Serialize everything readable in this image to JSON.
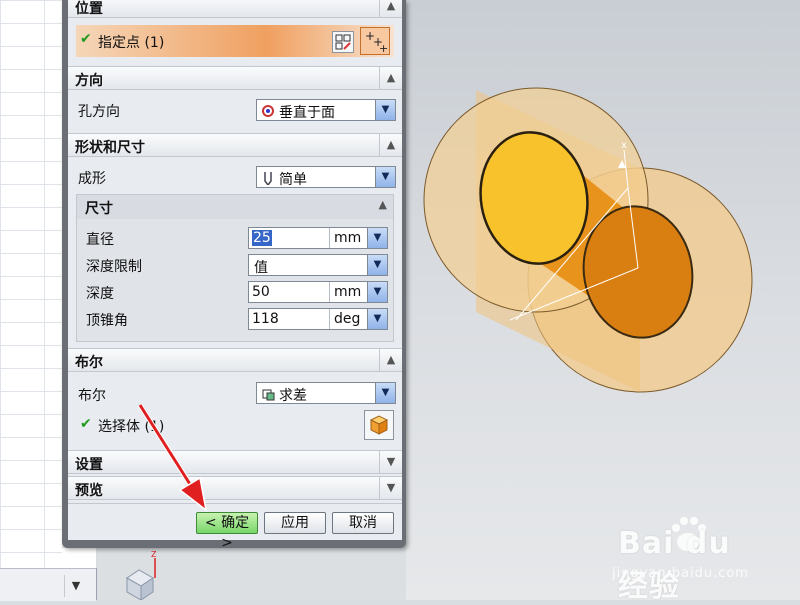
{
  "dialog": {
    "sections": {
      "position": {
        "title": "位置",
        "point_label": "指定点 (1)"
      },
      "direction": {
        "title": "方向",
        "hole_dir_label": "孔方向",
        "hole_dir_value": "垂直于面"
      },
      "shape": {
        "title": "形状和尺寸",
        "form_label": "成形",
        "form_value": "简单",
        "dims": {
          "title": "尺寸",
          "diameter": {
            "label": "直径",
            "value": "25",
            "unit": "mm"
          },
          "depth_limit": {
            "label": "深度限制",
            "value": "值"
          },
          "depth": {
            "label": "深度",
            "value": "50",
            "unit": "mm"
          },
          "tip_angle": {
            "label": "顶锥角",
            "value": "118",
            "unit": "deg"
          }
        }
      },
      "boolean": {
        "title": "布尔",
        "bool_label": "布尔",
        "bool_value": "求差",
        "select_body": "选择体 (1)"
      },
      "settings": {
        "title": "设置"
      },
      "preview": {
        "title": "预览"
      }
    },
    "buttons": {
      "ok": "< 确定 >",
      "apply": "应用",
      "cancel": "取消"
    }
  },
  "watermark": {
    "brand": "Bai du 经验",
    "sub": "jingyan.baidu.com"
  },
  "colors": {
    "accent_orange": "#f0a050",
    "cylinder": "#e8941c",
    "ok_green": "#78d66a",
    "arrow_red": "#e02020"
  }
}
